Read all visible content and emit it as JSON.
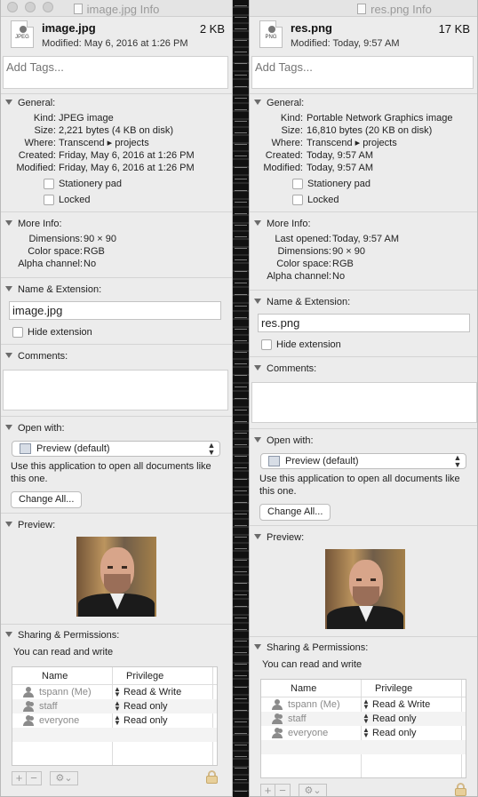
{
  "left": {
    "title": "image.jpg Info",
    "filename": "image.jpg",
    "filesize": "2 KB",
    "modified": "Modified: May 6, 2016 at 1:26 PM",
    "icon_badge": "JPEG",
    "tags_placeholder": "Add Tags...",
    "general_label": "General:",
    "general": [
      {
        "k": "Kind:",
        "v": "JPEG image"
      },
      {
        "k": "Size:",
        "v": "2,221 bytes (4 KB on disk)"
      },
      {
        "k": "Where:",
        "v": "Transcend ▸ projects"
      },
      {
        "k": "Created:",
        "v": "Friday, May 6, 2016 at 1:26 PM"
      },
      {
        "k": "Modified:",
        "v": "Friday, May 6, 2016 at 1:26 PM"
      }
    ],
    "stationery": "Stationery pad",
    "locked": "Locked",
    "moreinfo_label": "More Info:",
    "moreinfo": [
      {
        "k": "Dimensions:",
        "v": "90 × 90"
      },
      {
        "k": "Color space:",
        "v": "RGB"
      },
      {
        "k": "Alpha channel:",
        "v": "No"
      }
    ],
    "name_ext_label": "Name & Extension:",
    "name_value": "image.jpg",
    "hide_ext": "Hide extension",
    "comments_label": "Comments:",
    "openwith_label": "Open with:",
    "app": "Preview (default)",
    "use_app_note": "Use this application to open all documents like this one.",
    "change_all": "Change All...",
    "preview_label": "Preview:",
    "sharing_label": "Sharing & Permissions:",
    "sharing_note": "You can read and write",
    "col_name": "Name",
    "col_priv": "Privilege",
    "perms": [
      {
        "name": "tspann (Me)",
        "priv": "Read & Write",
        "icon": "single-user-icon"
      },
      {
        "name": "staff",
        "priv": "Read only",
        "icon": "group-icon"
      },
      {
        "name": "everyone",
        "priv": "Read only",
        "icon": "everyone-icon"
      }
    ]
  },
  "right": {
    "title": "res.png Info",
    "filename": "res.png",
    "filesize": "17 KB",
    "modified": "Modified: Today, 9:57 AM",
    "icon_badge": "PNG",
    "tags_placeholder": "Add Tags...",
    "general_label": "General:",
    "general": [
      {
        "k": "Kind:",
        "v": "Portable Network Graphics image"
      },
      {
        "k": "Size:",
        "v": "16,810 bytes (20 KB on disk)"
      },
      {
        "k": "Where:",
        "v": "Transcend ▸ projects"
      },
      {
        "k": "Created:",
        "v": "Today, 9:57 AM"
      },
      {
        "k": "Modified:",
        "v": "Today, 9:57 AM"
      }
    ],
    "stationery": "Stationery pad",
    "locked": "Locked",
    "moreinfo_label": "More Info:",
    "moreinfo": [
      {
        "k": "Last opened:",
        "v": "Today, 9:57 AM"
      },
      {
        "k": "Dimensions:",
        "v": "90 × 90"
      },
      {
        "k": "Color space:",
        "v": "RGB"
      },
      {
        "k": "Alpha channel:",
        "v": "No"
      }
    ],
    "name_ext_label": "Name & Extension:",
    "name_value": "res.png",
    "hide_ext": "Hide extension",
    "comments_label": "Comments:",
    "openwith_label": "Open with:",
    "app": "Preview (default)",
    "use_app_note": "Use this application to open all documents like this one.",
    "change_all": "Change All...",
    "preview_label": "Preview:",
    "sharing_label": "Sharing & Permissions:",
    "sharing_note": "You can read and write",
    "col_name": "Name",
    "col_priv": "Privilege",
    "perms": [
      {
        "name": "tspann (Me)",
        "priv": "Read & Write",
        "icon": "single-user-icon"
      },
      {
        "name": "staff",
        "priv": "Read only",
        "icon": "group-icon"
      },
      {
        "name": "everyone",
        "priv": "Read only",
        "icon": "everyone-icon"
      }
    ]
  }
}
